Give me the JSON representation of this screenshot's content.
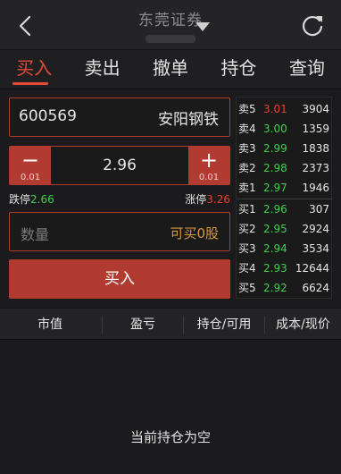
{
  "header": {
    "title": "东莞证券",
    "back_icon": "chevron-left-icon",
    "dropdown_icon": "caret-down-icon",
    "refresh_icon": "refresh-icon"
  },
  "tabs": [
    {
      "label": "买入",
      "active": true
    },
    {
      "label": "卖出",
      "active": false
    },
    {
      "label": "撤单",
      "active": false
    },
    {
      "label": "持仓",
      "active": false
    },
    {
      "label": "查询",
      "active": false
    }
  ],
  "order": {
    "code": "600569",
    "name": "安阳钢铁",
    "price": "2.96",
    "minus_delta": "0.01",
    "plus_delta": "0.01",
    "limit_down_label": "跌停",
    "limit_down_value": "2.66",
    "limit_up_label": "涨停",
    "limit_up_value": "3.26",
    "quantity_placeholder": "数量",
    "available_text": "可买0股",
    "buy_button": "买入"
  },
  "order_book": {
    "asks": [
      {
        "label": "卖5",
        "price": "3.01",
        "volume": "3904"
      },
      {
        "label": "卖4",
        "price": "3.00",
        "volume": "1359"
      },
      {
        "label": "卖3",
        "price": "2.99",
        "volume": "1838"
      },
      {
        "label": "卖2",
        "price": "2.98",
        "volume": "2373"
      },
      {
        "label": "卖1",
        "price": "2.97",
        "volume": "1946"
      }
    ],
    "bids": [
      {
        "label": "买1",
        "price": "2.96",
        "volume": "307"
      },
      {
        "label": "买2",
        "price": "2.95",
        "volume": "2924"
      },
      {
        "label": "买3",
        "price": "2.94",
        "volume": "3534"
      },
      {
        "label": "买4",
        "price": "2.93",
        "volume": "12644"
      },
      {
        "label": "买5",
        "price": "2.92",
        "volume": "6624"
      }
    ]
  },
  "holdings": {
    "columns": [
      "市值",
      "盈亏",
      "持仓/可用",
      "成本/现价"
    ],
    "empty_message": "当前持仓为空"
  },
  "colors": {
    "accent": "#e64a37",
    "button": "#b13b30",
    "up": "#e8412e",
    "down": "#3fcf4b",
    "available": "#d29a3a"
  }
}
